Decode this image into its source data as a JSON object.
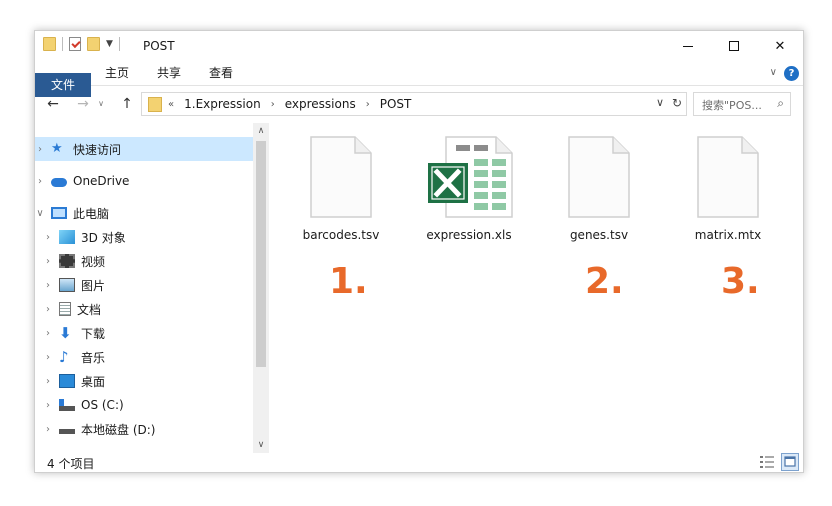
{
  "window": {
    "title": "POST",
    "controls": {
      "minimize": "minimize",
      "maximize": "maximize",
      "close": "✕"
    }
  },
  "ribbon": {
    "tabs": [
      "文件",
      "主页",
      "共享",
      "查看"
    ],
    "accent": "#2a5a93",
    "help": "?"
  },
  "address": {
    "overflow": "«",
    "path": [
      "1.Expression",
      "expressions",
      "POST"
    ],
    "search_placeholder": "搜索\"POS..."
  },
  "navpane": {
    "items": [
      {
        "label": "快速访问",
        "icon": "star-icon",
        "selected": true
      },
      {
        "label": "OneDrive",
        "icon": "cloud-icon"
      },
      {
        "label": "此电脑",
        "icon": "computer-icon",
        "expanded": true
      },
      {
        "label": "3D 对象",
        "icon": "cube-icon"
      },
      {
        "label": "视频",
        "icon": "film-icon"
      },
      {
        "label": "图片",
        "icon": "picture-icon"
      },
      {
        "label": "文档",
        "icon": "document-icon"
      },
      {
        "label": "下载",
        "icon": "download-icon"
      },
      {
        "label": "音乐",
        "icon": "music-icon"
      },
      {
        "label": "桌面",
        "icon": "desktop-icon"
      },
      {
        "label": "OS (C:)",
        "icon": "drive-os-icon"
      },
      {
        "label": "本地磁盘 (D:)",
        "icon": "drive-icon"
      }
    ]
  },
  "files": [
    {
      "name": "barcodes.tsv",
      "icon": "blank-file-icon"
    },
    {
      "name": "expression.xls",
      "icon": "excel-file-icon"
    },
    {
      "name": "genes.tsv",
      "icon": "blank-file-icon"
    },
    {
      "name": "matrix.mtx",
      "icon": "blank-file-icon"
    }
  ],
  "annotations": [
    "1.",
    "2.",
    "3."
  ],
  "annotation_color": "#e8692a",
  "status": {
    "item_count": "4 个项目"
  }
}
